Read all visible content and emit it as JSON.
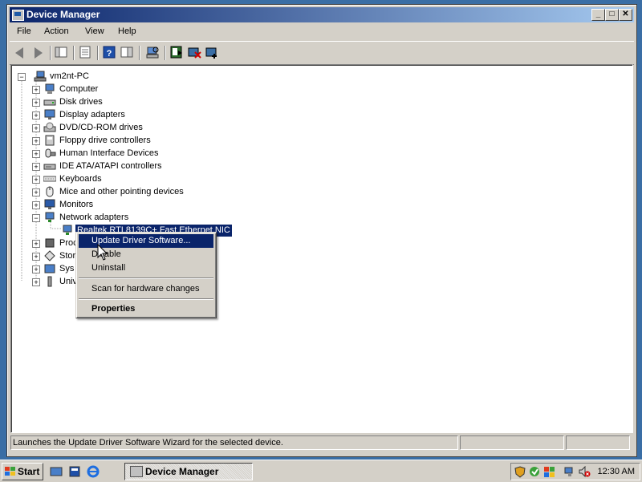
{
  "window": {
    "title": "Device Manager",
    "controls": {
      "minimize": "_",
      "maximize": "□",
      "close": "✕"
    }
  },
  "menubar": [
    "File",
    "Action",
    "View",
    "Help"
  ],
  "toolbar": {
    "icons": [
      "back-icon",
      "forward-icon",
      "show-hide-console-tree-icon",
      "properties-icon",
      "help-icon",
      "action-pane-icon",
      "scan-hardware-icon",
      "update-driver-icon",
      "uninstall-icon",
      "disable-icon"
    ]
  },
  "tree": {
    "root": "vm2nt-PC",
    "categories": [
      {
        "label": "Computer",
        "icon": "computer-icon"
      },
      {
        "label": "Disk drives",
        "icon": "disk-drive-icon"
      },
      {
        "label": "Display adapters",
        "icon": "display-adapter-icon"
      },
      {
        "label": "DVD/CD-ROM drives",
        "icon": "dvd-drive-icon"
      },
      {
        "label": "Floppy drive controllers",
        "icon": "floppy-controller-icon"
      },
      {
        "label": "Human Interface Devices",
        "icon": "hid-icon"
      },
      {
        "label": "IDE ATA/ATAPI controllers",
        "icon": "ide-controller-icon"
      },
      {
        "label": "Keyboards",
        "icon": "keyboard-icon"
      },
      {
        "label": "Mice and other pointing devices",
        "icon": "mouse-icon"
      },
      {
        "label": "Monitors",
        "icon": "monitor-icon"
      },
      {
        "label": "Network adapters",
        "icon": "network-adapter-icon",
        "expanded": true
      }
    ],
    "selected_child": "Realtek RTL8139C+ Fast Ethernet NIC",
    "partially_hidden": [
      {
        "label": "Proc",
        "icon": "processor-icon"
      },
      {
        "label": "Stor",
        "icon": "storage-controller-icon"
      },
      {
        "label": "Sys",
        "icon": "system-device-icon"
      },
      {
        "label": "Univ",
        "icon": "usb-controller-icon"
      }
    ]
  },
  "context_menu": {
    "items": [
      "Update Driver Software...",
      "Disable",
      "Uninstall"
    ],
    "scan": "Scan for hardware changes",
    "properties": "Properties",
    "highlighted": "Update Driver Software..."
  },
  "statusbar": {
    "text": "Launches the Update Driver Software Wizard for the selected device."
  },
  "taskbar": {
    "start": "Start",
    "task": "Device Manager",
    "clock": "12:30 AM"
  },
  "colors": {
    "selection": "#0a246a",
    "title_start": "#0a246a",
    "title_end": "#a6caf0",
    "desktop": "#3a6ea5"
  }
}
